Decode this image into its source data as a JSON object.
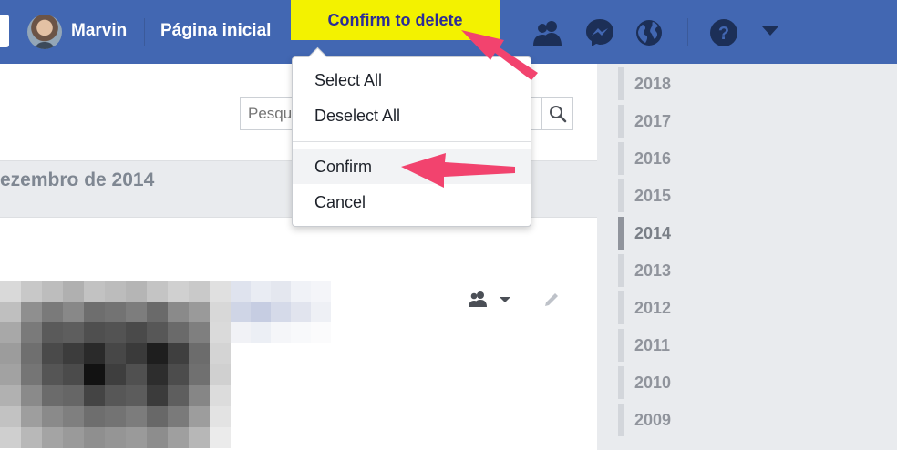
{
  "header": {
    "user_name": "Marvin",
    "home_label": "Página inicial",
    "highlight_label": "Confirm to delete",
    "icons": [
      "friends-icon",
      "messenger-icon",
      "globe-icon",
      "help-icon",
      "caret-down-icon"
    ]
  },
  "search": {
    "value": "",
    "placeholder": "Pesquisar"
  },
  "month_header": "ezembro de 2014",
  "dropdown": {
    "items": [
      {
        "label": "Select All"
      },
      {
        "label": "Deselect All"
      },
      {
        "label": "Confirm"
      },
      {
        "label": "Cancel"
      }
    ]
  },
  "timeline": {
    "years": [
      "2018",
      "2017",
      "2016",
      "2015",
      "2014",
      "2013",
      "2012",
      "2011",
      "2010",
      "2009"
    ],
    "active_year": "2014"
  },
  "colors": {
    "topbar": "#4267b2",
    "highlight": "#f3f200",
    "arrow": "#f2436e"
  }
}
